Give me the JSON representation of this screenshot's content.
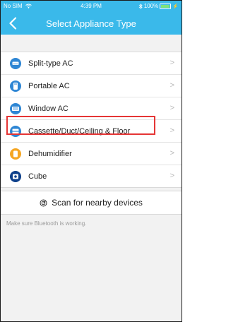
{
  "status_bar": {
    "carrier": "No SIM",
    "wifi_icon": "wifi-icon",
    "time": "4:39 PM",
    "battery_text": "100%",
    "battery_color": "#7ee37a"
  },
  "nav": {
    "title": "Select Appliance Type",
    "back_icon": "chevron-left-icon",
    "bar_color": "#3ab9ea"
  },
  "appliances": [
    {
      "label": "Split-type AC",
      "icon": "split-ac-icon",
      "color": "#2e86d4"
    },
    {
      "label": "Portable AC",
      "icon": "portable-ac-icon",
      "color": "#2e86d4"
    },
    {
      "label": "Window AC",
      "icon": "window-ac-icon",
      "color": "#2e86d4"
    },
    {
      "label": "Cassette/Duct/Ceiling & Floor",
      "icon": "cassette-icon",
      "color": "#2e86d4"
    },
    {
      "label": "Dehumidifier",
      "icon": "dehumidifier-icon",
      "color": "#f5a623"
    },
    {
      "label": "Cube",
      "icon": "cube-icon",
      "color": "#0d3f8a"
    }
  ],
  "chevron_glyph": ">",
  "highlight_color": "#e53535",
  "scan": {
    "icon": "radar-icon",
    "label": "Scan for nearby devices"
  },
  "hint": "Make sure Bluetooth is working."
}
